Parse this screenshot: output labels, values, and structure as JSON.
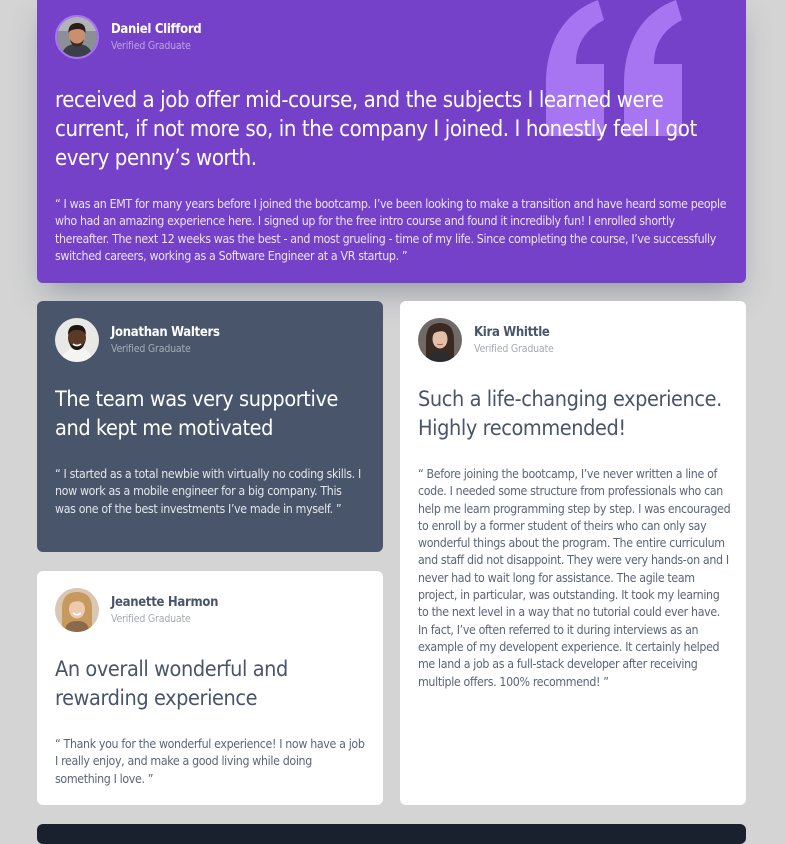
{
  "colors": {
    "page_background": "#d4d4d4",
    "violet": "#7541c8",
    "violet_quote_mark": "#a775f1",
    "grayish_blue": "#48556a",
    "white": "#ffffff",
    "blackish_blue": "#19212e"
  },
  "testimonials": [
    {
      "name": "Daniel Clifford",
      "role": "Verified Graduate",
      "avatar": "avatar-daniel",
      "headline": "received a job offer mid-course, and the subjects I learned were current, if not more so, in the company I joined. I honestly feel I got every penny’s worth.",
      "quote": "“ I was an EMT for many years before I joined the bootcamp. I’ve been looking to make a transition and have heard some people who had an amazing experience here. I signed up for the free intro course and found it incredibly fun! I enrolled shortly thereafter. The next 12 weeks was the best - and most grueling - time of my life. Since completing the course, I’ve successfully switched careers, working as a Software Engineer at a VR startup. ”"
    },
    {
      "name": "Jonathan Walters",
      "role": "Verified Graduate",
      "avatar": "avatar-jonathan",
      "headline": "The team was very supportive and kept me motivated",
      "quote": "“ I started as a total newbie with virtually no coding skills. I now work as a mobile engineer for a big company. This was one of the best investments I’ve made in myself. ”"
    },
    {
      "name": "Kira Whittle",
      "role": "Verified Graduate",
      "avatar": "avatar-kira",
      "headline": "Such a life-changing experience. Highly recommended!",
      "quote": "“ Before joining the bootcamp, I’ve never written a line of code. I needed some structure from professionals who can help me learn programming step by step. I was encouraged to enroll by a former student of theirs who can only say wonderful things about the program. The entire curriculum and staff did not disappoint. They were very hands-on and I never had to wait long for assistance. The agile team project, in particular, was outstanding. It took my learning to the next level in a way that no tutorial could ever have. In fact, I’ve often referred to it during interviews as an example of my developent experience. It certainly helped me land a job as a full-stack developer after receiving multiple offers. 100% recommend! ”"
    },
    {
      "name": "Jeanette Harmon",
      "role": "Verified Graduate",
      "avatar": "avatar-jeanette",
      "headline": "An overall wonderful and rewarding experience",
      "quote": "“ Thank you for the wonderful experience! I now have a job I really enjoy, and make a good living while doing something I love. ”"
    }
  ]
}
